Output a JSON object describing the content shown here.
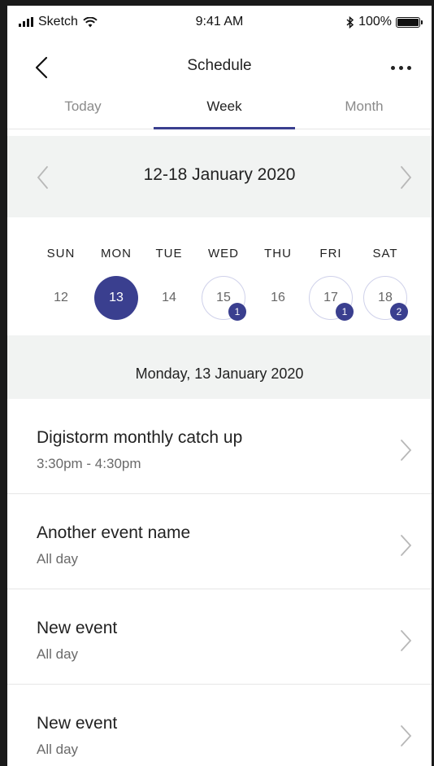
{
  "status_bar": {
    "carrier": "Sketch",
    "time": "9:41 AM",
    "battery": "100%",
    "icons": [
      "signal-icon",
      "wifi-icon",
      "bluetooth-icon",
      "battery-icon"
    ]
  },
  "nav": {
    "title": "Schedule",
    "back_icon": "back-chevron-icon",
    "more_icon": "more-dots-icon"
  },
  "tabs": [
    {
      "label": "Today",
      "active": false
    },
    {
      "label": "Week",
      "active": true
    },
    {
      "label": "Month",
      "active": false
    }
  ],
  "week": {
    "range": "12-18 January 2020",
    "days": [
      {
        "name": "SUN",
        "num": "12",
        "selected": false,
        "events": null
      },
      {
        "name": "MON",
        "num": "13",
        "selected": true,
        "events": null
      },
      {
        "name": "TUE",
        "num": "14",
        "selected": false,
        "events": null
      },
      {
        "name": "WED",
        "num": "15",
        "selected": false,
        "events": "1"
      },
      {
        "name": "THU",
        "num": "16",
        "selected": false,
        "events": null
      },
      {
        "name": "FRI",
        "num": "17",
        "selected": false,
        "events": "1"
      },
      {
        "name": "SAT",
        "num": "18",
        "selected": false,
        "events": "2"
      }
    ]
  },
  "selected_date": "Monday, 13 January 2020",
  "events": [
    {
      "title": "Digistorm monthly catch up",
      "time": "3:30pm - 4:30pm"
    },
    {
      "title": "Another event name",
      "time": "All day"
    },
    {
      "title": "New event",
      "time": "All day"
    },
    {
      "title": "New event",
      "time": "All day"
    }
  ],
  "colors": {
    "accent": "#3a3f8f",
    "header_bg": "#f1f3f2",
    "muted_text": "#8a8a8a"
  }
}
